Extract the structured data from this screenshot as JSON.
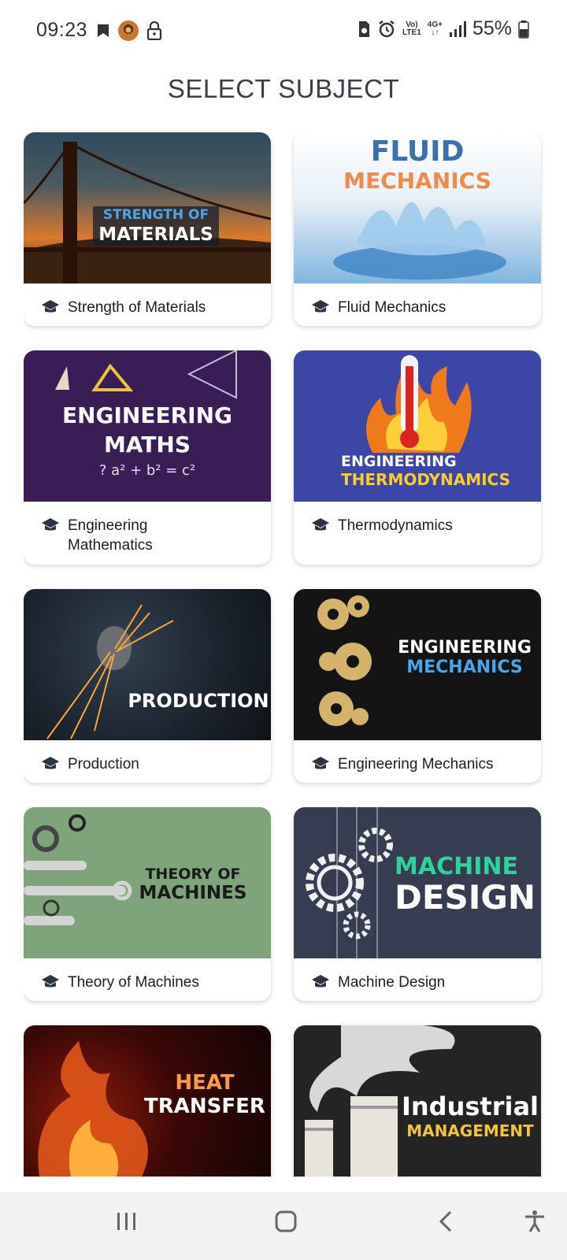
{
  "status_bar": {
    "time": "09:23",
    "battery_percent": "55%",
    "net_top": "Vo)",
    "net_bottom": "LTE1",
    "gen_top": "4G+",
    "gen_bottom": "↓↑"
  },
  "page": {
    "title": "SELECT SUBJECT"
  },
  "subjects": [
    {
      "label": "Strength of Materials",
      "art": [
        "STRENGTH OF",
        "MATERIALS"
      ]
    },
    {
      "label": "Fluid Mechanics",
      "art": [
        "FLUID",
        "MECHANICS"
      ]
    },
    {
      "label": "Engineering Mathematics",
      "art": [
        "ENGINEERING",
        "MATHS",
        "? a² + b² = c²"
      ]
    },
    {
      "label": "Thermodynamics",
      "art": [
        "ENGINEERING",
        "THERMODYNAMICS"
      ]
    },
    {
      "label": "Production",
      "art": [
        "PRODUCTION"
      ]
    },
    {
      "label": "Engineering Mechanics",
      "art": [
        "ENGINEERING",
        "MECHANICS"
      ]
    },
    {
      "label": "Theory of Machines",
      "art": [
        "THEORY OF",
        "MACHINES"
      ]
    },
    {
      "label": "Machine Design",
      "art": [
        "MACHINE",
        "DESIGN"
      ]
    },
    {
      "label": "",
      "art": [
        "HEAT",
        "TRANSFER"
      ]
    },
    {
      "label": "",
      "art": [
        "Industrial",
        "MANAGEMENT"
      ]
    }
  ],
  "icons": {
    "subject": "graduation-cap-icon",
    "nav_recents": "recents-icon",
    "nav_home": "home-icon",
    "nav_back": "back-icon",
    "nav_accessibility": "accessibility-icon"
  },
  "colors": {
    "title": "#3a3f4a",
    "nav_background": "#f2f2f2"
  }
}
